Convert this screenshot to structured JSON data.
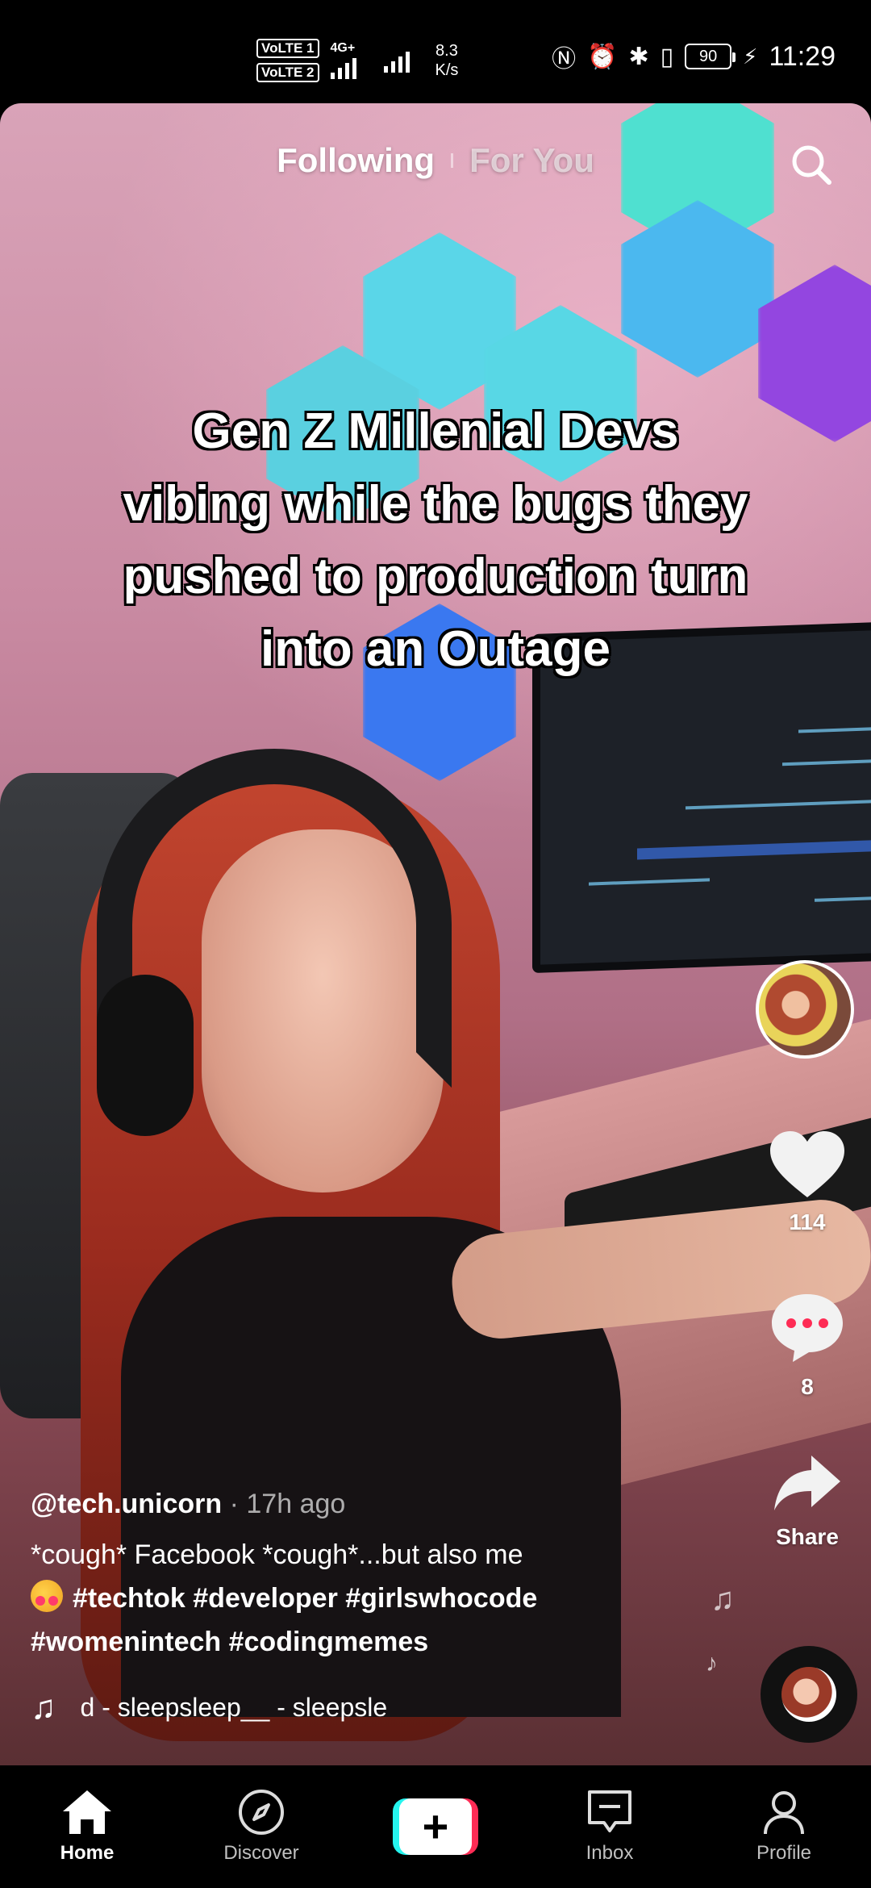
{
  "status_bar": {
    "volte1": "VoLTE 1",
    "volte2": "VoLTE 2",
    "network": "4G+",
    "speed_value": "8.3",
    "speed_unit": "K/s",
    "battery": "90",
    "time": "11:29"
  },
  "top_tabs": {
    "following": "Following",
    "for_you": "For You"
  },
  "video": {
    "caption": "Gen Z Millenial Devs vibing while the bugs they pushed to production turn into an Outage"
  },
  "actions": {
    "like_count": "114",
    "comment_count": "8",
    "share_label": "Share"
  },
  "post": {
    "username": "@tech.unicorn",
    "separator": " · ",
    "time_ago": "17h ago",
    "description": "*cough* Facebook *cough*...but also me",
    "hashtags_line1": "#techtok #developer #girlswhocode",
    "hashtags_line2": "#womenintech #codingmemes",
    "music": "d - sleepsleep__ - sleepsle"
  },
  "bottom_nav": {
    "home": "Home",
    "discover": "Discover",
    "create": "+",
    "inbox": "Inbox",
    "profile": "Profile"
  },
  "colors": {
    "accent_red": "#fe2c55",
    "accent_cyan": "#25f4ee"
  }
}
